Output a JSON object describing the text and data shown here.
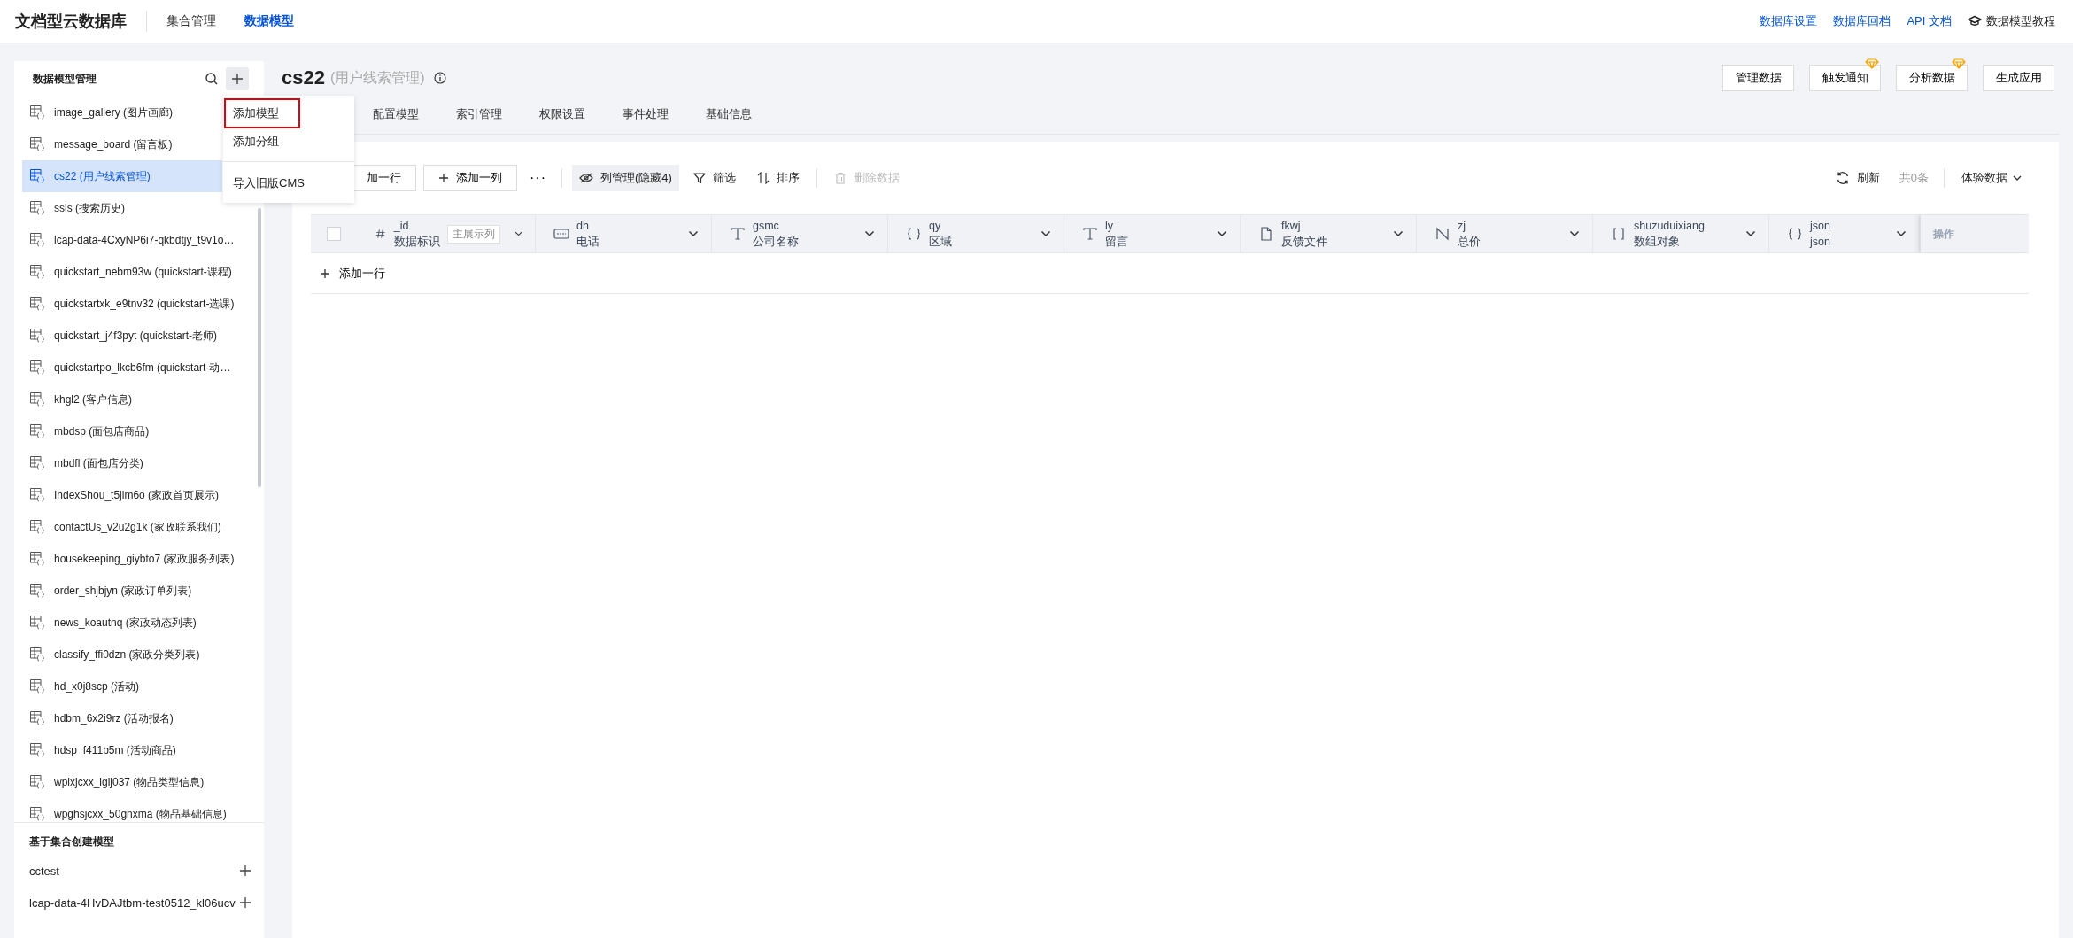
{
  "header": {
    "brand": "文档型云数据库",
    "nav": [
      {
        "label": "集合管理",
        "selected": false
      },
      {
        "label": "数据模型",
        "selected": true
      }
    ],
    "links": [
      "数据库设置",
      "数据库回档",
      "API 文档"
    ],
    "tutorial": "数据模型教程"
  },
  "sidebar": {
    "title": "数据模型管理",
    "models": [
      {
        "label": "image_gallery (图片画廊)",
        "selected": false
      },
      {
        "label": "message_board (留言板)",
        "selected": false
      },
      {
        "label": "cs22 (用户线索管理)",
        "selected": true
      },
      {
        "label": "ssls (搜索历史)",
        "selected": false
      },
      {
        "label": "lcap-data-4CxyNP6i7-qkbdtjy_t9v1o…",
        "selected": false
      },
      {
        "label": "quickstart_nebm93w (quickstart-课程)",
        "selected": false
      },
      {
        "label": "quickstartxk_e9tnv32 (quickstart-选课)",
        "selected": false
      },
      {
        "label": "quickstart_j4f3pyt (quickstart-老师)",
        "selected": false
      },
      {
        "label": "quickstartpo_lkcb6fm (quickstart-动…",
        "selected": false
      },
      {
        "label": "khgl2 (客户信息)",
        "selected": false
      },
      {
        "label": "mbdsp (面包店商品)",
        "selected": false
      },
      {
        "label": "mbdfl (面包店分类)",
        "selected": false
      },
      {
        "label": "IndexShou_t5jlm6o (家政首页展示)",
        "selected": false
      },
      {
        "label": "contactUs_v2u2g1k (家政联系我们)",
        "selected": false
      },
      {
        "label": "housekeeping_giybto7 (家政服务列表)",
        "selected": false
      },
      {
        "label": "order_shjbjyn (家政订单列表)",
        "selected": false
      },
      {
        "label": "news_koautnq (家政动态列表)",
        "selected": false
      },
      {
        "label": "classify_ffi0dzn (家政分类列表)",
        "selected": false
      },
      {
        "label": "hd_x0j8scp (活动)",
        "selected": false
      },
      {
        "label": "hdbm_6x2i9rz (活动报名)",
        "selected": false
      },
      {
        "label": "hdsp_f411b5m (活动商品)",
        "selected": false
      },
      {
        "label": "wplxjcxx_igij037 (物品类型信息)",
        "selected": false
      },
      {
        "label": "wpghsjcxx_50gnxma (物品基础信息)",
        "selected": false
      }
    ],
    "collections_title": "基于集合创建模型",
    "collections": [
      "cctest",
      "lcap-data-4HvDAJtbm-test0512_kl06ucv"
    ]
  },
  "add_menu": {
    "groups": [
      [
        {
          "label": "添加模型",
          "highlighted": true
        },
        {
          "label": "添加分组",
          "highlighted": false
        }
      ],
      [
        {
          "label": "导入旧版CMS",
          "highlighted": false
        }
      ]
    ]
  },
  "page": {
    "title": "cs22",
    "subtitle": "(用户线索管理)",
    "actions": [
      {
        "label": "管理数据",
        "premium": false
      },
      {
        "label": "触发通知",
        "premium": true
      },
      {
        "label": "分析数据",
        "premium": true
      },
      {
        "label": "生成应用",
        "premium": false
      }
    ]
  },
  "tabs": [
    {
      "label": "配置模型",
      "selected": false
    },
    {
      "label": "索引管理",
      "selected": false
    },
    {
      "label": "权限设置",
      "selected": false
    },
    {
      "label": "事件处理",
      "selected": false
    },
    {
      "label": "基础信息",
      "selected": false
    }
  ],
  "toolbar": {
    "add_row": "加一行",
    "add_column": "添加一列",
    "more": "···",
    "columns": "列管理(隐藏4)",
    "filter": "筛选",
    "sort": "排序",
    "delete": {
      "label": "删除数据",
      "disabled": true
    },
    "refresh": "刷新",
    "count": "共0条",
    "data_mode": "体验数据"
  },
  "table": {
    "columns": [
      {
        "name": "_id",
        "label": "数据标识",
        "kind": "id",
        "tag": "主展示列"
      },
      {
        "name": "dh",
        "label": "电话",
        "kind": "phone"
      },
      {
        "name": "gsmc",
        "label": "公司名称",
        "kind": "text"
      },
      {
        "name": "qy",
        "label": "区域",
        "kind": "object"
      },
      {
        "name": "ly",
        "label": "留言",
        "kind": "text"
      },
      {
        "name": "fkwj",
        "label": "反馈文件",
        "kind": "file"
      },
      {
        "name": "zj",
        "label": "总价",
        "kind": "number"
      },
      {
        "name": "shuzuduixiang",
        "label": "数组对象",
        "kind": "array"
      },
      {
        "name": "json",
        "label": "json",
        "kind": "object"
      }
    ],
    "select_all": {
      "checked": false
    },
    "action_column": "操作",
    "add_row": "添加一行"
  }
}
